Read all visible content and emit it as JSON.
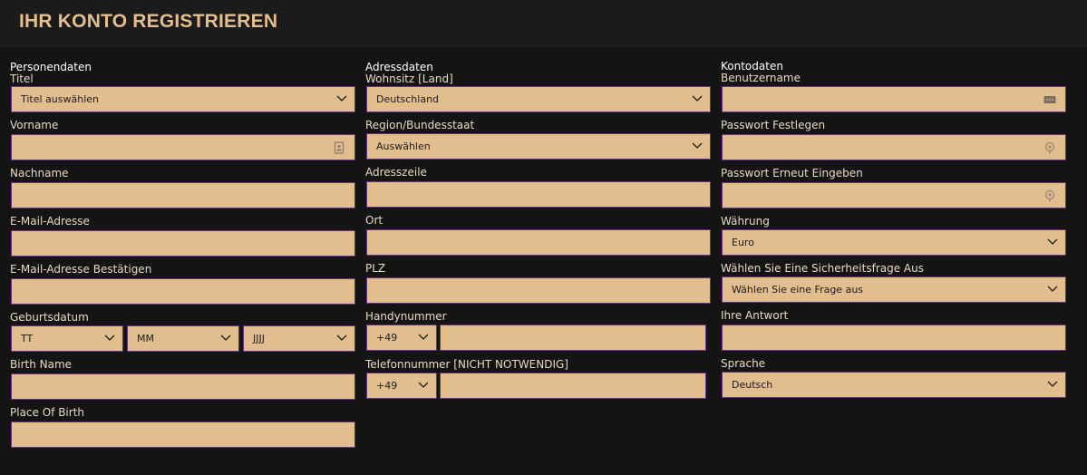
{
  "header": {
    "title": "IHR KONTO REGISTRIEREN"
  },
  "personal": {
    "section": "Personendaten",
    "title": {
      "label": "Titel",
      "value": "Titel auswählen"
    },
    "first_name": {
      "label": "Vorname"
    },
    "last_name": {
      "label": "Nachname"
    },
    "email": {
      "label": "E-Mail-Adresse"
    },
    "email_confirm": {
      "label": "E-Mail-Adresse Bestätigen"
    },
    "birthdate": {
      "label": "Geburtsdatum",
      "day": "TT",
      "month": "MM",
      "year": "JJJJ"
    },
    "birth_name": {
      "label": "Birth Name"
    },
    "place_of_birth": {
      "label": "Place Of Birth"
    }
  },
  "address": {
    "section": "Adressdaten",
    "country": {
      "label": "Wohnsitz [Land]",
      "value": "Deutschland"
    },
    "region": {
      "label": "Region/Bundesstaat",
      "value": "Auswählen"
    },
    "address_line": {
      "label": "Adresszeile"
    },
    "city": {
      "label": "Ort"
    },
    "zip": {
      "label": "PLZ"
    },
    "mobile": {
      "label": "Handynummer",
      "prefix": "+49"
    },
    "phone": {
      "label": "Telefonnummer [NICHT NOTWENDIG]",
      "prefix": "+49"
    }
  },
  "account": {
    "section": "Kontodaten",
    "username": {
      "label": "Benutzername"
    },
    "password": {
      "label": "Passwort Festlegen"
    },
    "password_confirm": {
      "label": "Passwort Erneut Eingeben"
    },
    "currency": {
      "label": "Währung",
      "value": "Euro"
    },
    "security_question": {
      "label": "Wählen Sie Eine Sicherheitsfrage Aus",
      "value": "Wählen Sie eine Frage aus"
    },
    "answer": {
      "label": "Ihre Antwort"
    },
    "language": {
      "label": "Sprache",
      "value": "Deutsch"
    }
  },
  "colors": {
    "field_bg": "#e2bd8d",
    "field_border": "#6b2f86",
    "title": "#e5be8d",
    "page_bg": "#141414"
  }
}
